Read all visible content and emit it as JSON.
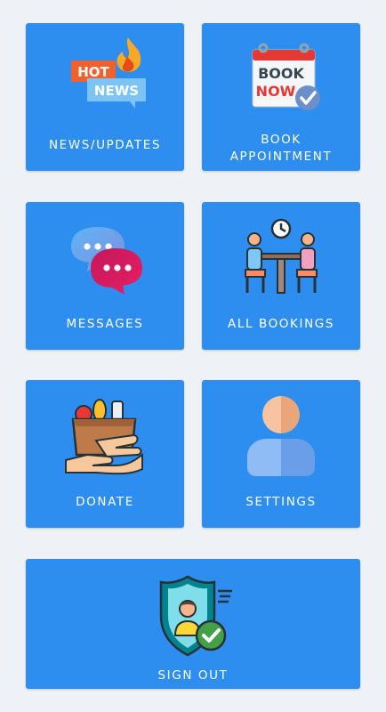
{
  "tiles": {
    "news": {
      "label": "NEWS/UPDATES",
      "icon": "hot-news-icon"
    },
    "book": {
      "label": "BOOK\nAPPOINTMENT",
      "icon": "book-now-calendar-icon"
    },
    "messages": {
      "label": "MESSAGES",
      "icon": "chat-bubbles-icon"
    },
    "bookings": {
      "label": "ALL BOOKINGS",
      "icon": "meeting-people-icon"
    },
    "donate": {
      "label": "DONATE",
      "icon": "donation-box-icon"
    },
    "settings": {
      "label": "SETTINGS",
      "icon": "user-profile-icon"
    },
    "signout": {
      "label": "SIGN OUT",
      "icon": "security-shield-user-icon"
    }
  },
  "icon_text": {
    "hot": "HOT",
    "news": "NEWS",
    "book": "BOOK",
    "now": "NOW"
  },
  "colors": {
    "tile": "#2d8ef0",
    "background": "#eef1f5",
    "label": "#ffffff"
  }
}
